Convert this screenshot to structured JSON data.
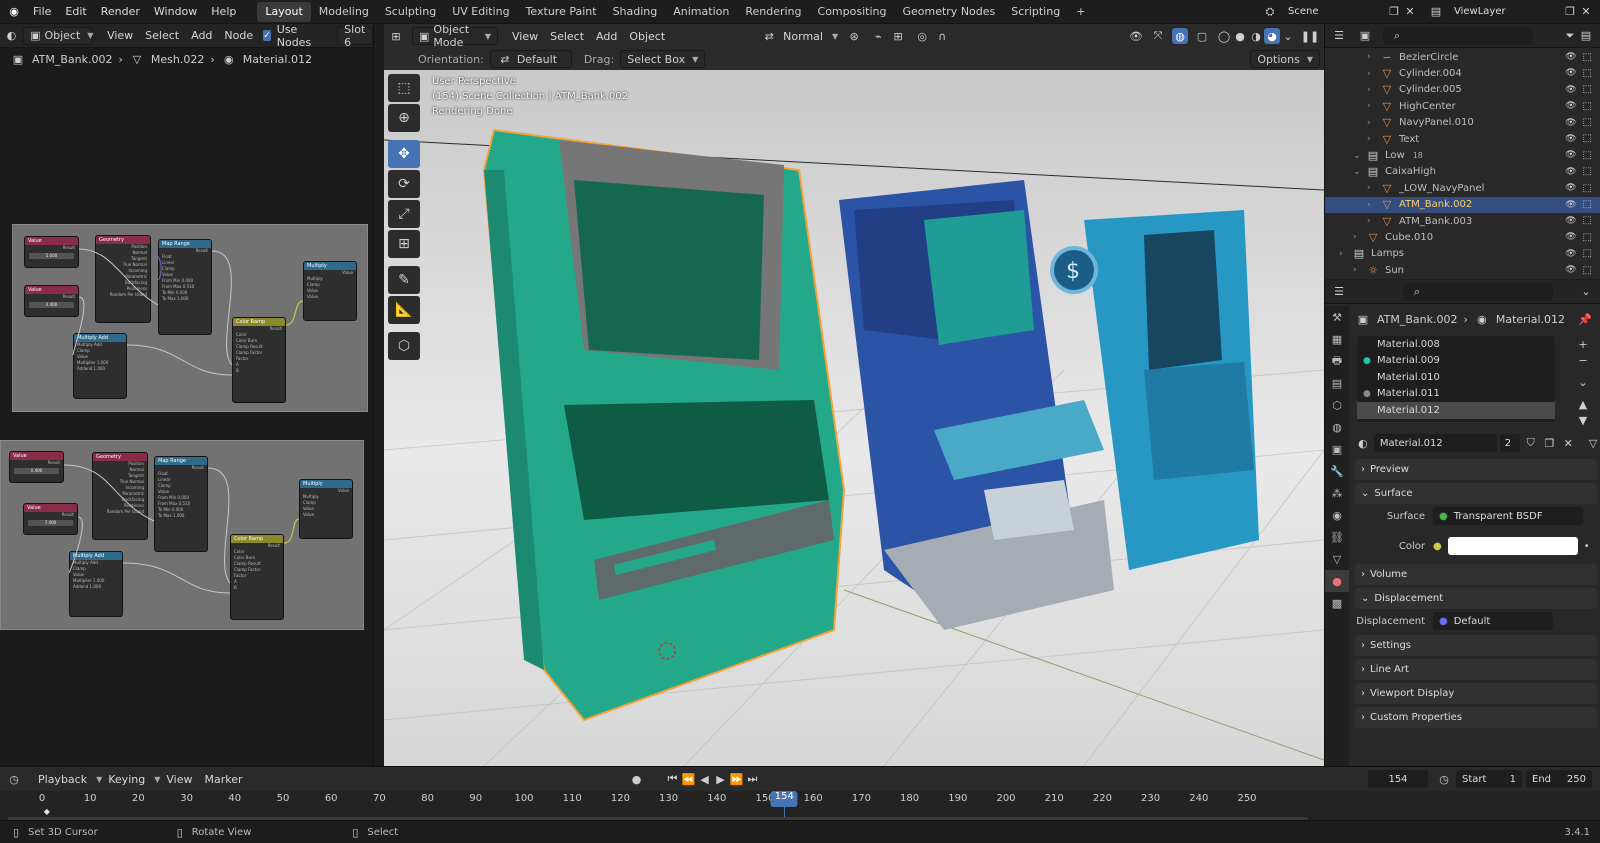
{
  "topbar": {
    "menus": [
      "File",
      "Edit",
      "Render",
      "Window",
      "Help"
    ],
    "workspaces": [
      "Layout",
      "Modeling",
      "Sculpting",
      "UV Editing",
      "Texture Paint",
      "Shading",
      "Animation",
      "Rendering",
      "Compositing",
      "Geometry Nodes",
      "Scripting"
    ],
    "active_workspace": "Layout",
    "add_workspace": "+",
    "scene": "Scene",
    "view_layer": "ViewLayer"
  },
  "node_editor": {
    "mode": "Object",
    "menus": [
      "View",
      "Select",
      "Add",
      "Node"
    ],
    "use_nodes_label": "Use Nodes",
    "slot": "Slot 6",
    "breadcrumb": [
      "ATM_Bank.002",
      "Mesh.022",
      "Material.012"
    ],
    "node_titles": {
      "value": "Value",
      "geometry": "Geometry",
      "map_range": "Map Range",
      "multiply": "Multiply",
      "multiply_add": "Multiply Add",
      "color_ramp": "Color Ramp"
    },
    "value_a": "5.000",
    "value_b": "0.400",
    "value_c": "0.400",
    "value_d": "7.000",
    "geometry_outputs": [
      "Position",
      "Normal",
      "Tangent",
      "True Normal",
      "Incoming",
      "Parametric",
      "Backfacing",
      "Pointiness",
      "Random Per Island"
    ],
    "map_range_fields": [
      "Float",
      "Linear",
      "Clamp",
      "Value",
      "From Min 0.000",
      "From Max 0.510",
      "To Min 0.000",
      "To Max 1.000"
    ],
    "multiply_add_fields": [
      "Multiply Add",
      "Clamp",
      "Value",
      "Multiplier 1.000",
      "Addend 1.000"
    ],
    "color_ramp_fields": [
      "Color",
      "Color Burn",
      "Clamp Result",
      "Clamp Factor",
      "Factor",
      "A",
      "B"
    ],
    "multiply_fields": [
      "Multiply",
      "Clamp",
      "Value",
      "Value"
    ],
    "result_label": "Result"
  },
  "viewport": {
    "mode": "Object Mode",
    "menus": [
      "View",
      "Select",
      "Add",
      "Object"
    ],
    "transform_orientation": "Normal",
    "orientation_label": "Orientation:",
    "orientation_value": "Default",
    "drag_label": "Drag:",
    "drag_value": "Select Box",
    "options_label": "Options",
    "overlay_lines": [
      "User Perspective",
      "(154) Scene Collection | ATM_Bank.002",
      "Rendering Done"
    ],
    "colors": {
      "teal": "#23a98a",
      "blue": "#2d5fb8",
      "cyan": "#2aa0c8",
      "selection": "#f4a23a"
    }
  },
  "outliner": {
    "rows": [
      {
        "name": "BezierCircle",
        "depth": 3,
        "icon": "curve-icon",
        "selected": false
      },
      {
        "name": "Cylinder.004",
        "depth": 3,
        "icon": "mesh-icon",
        "selected": false
      },
      {
        "name": "Cylinder.005",
        "depth": 3,
        "icon": "mesh-icon",
        "selected": false
      },
      {
        "name": "HighCenter",
        "depth": 3,
        "icon": "mesh-icon",
        "selected": false
      },
      {
        "name": "NavyPanel.010",
        "depth": 3,
        "icon": "mesh-icon",
        "selected": false
      },
      {
        "name": "Text",
        "depth": 3,
        "icon": "mesh-icon",
        "selected": false
      },
      {
        "name": "Low",
        "depth": 2,
        "icon": "collection-icon",
        "selected": false,
        "badge": "18"
      },
      {
        "name": "CaixaHigh",
        "depth": 2,
        "icon": "collection-icon",
        "selected": false
      },
      {
        "name": "_LOW_NavyPanel",
        "depth": 3,
        "icon": "mesh-icon",
        "selected": false
      },
      {
        "name": "ATM_Bank.002",
        "depth": 3,
        "icon": "mesh-icon",
        "selected": true
      },
      {
        "name": "ATM_Bank.003",
        "depth": 3,
        "icon": "mesh-icon",
        "selected": false
      },
      {
        "name": "Cube.010",
        "depth": 2,
        "icon": "mesh-icon",
        "selected": false
      },
      {
        "name": "Lamps",
        "depth": 1,
        "icon": "collection-icon",
        "selected": false
      },
      {
        "name": "Sun",
        "depth": 2,
        "icon": "light-icon",
        "selected": false
      }
    ]
  },
  "properties": {
    "breadcrumb_object": "ATM_Bank.002",
    "breadcrumb_material": "Material.012",
    "material_slots": [
      "Material.008",
      "Material.009",
      "Material.010",
      "Material.011",
      "Material.012"
    ],
    "active_slot_index": 4,
    "material_name": "Material.012",
    "users": "2",
    "panels": {
      "preview": "Preview",
      "surface": "Surface",
      "volume": "Volume",
      "displacement": "Displacement",
      "settings": "Settings",
      "line_art": "Line Art",
      "viewport_display": "Viewport Display",
      "custom_properties": "Custom Properties"
    },
    "surface_label": "Surface",
    "surface_value": "Transparent BSDF",
    "color_label": "Color",
    "color_value": "#ffffff",
    "displacement_label": "Displacement",
    "displacement_value": "Default"
  },
  "timeline": {
    "menus": [
      "Playback",
      "Keying",
      "View",
      "Marker"
    ],
    "current_frame": "154",
    "start_label": "Start",
    "start_value": "1",
    "end_label": "End",
    "end_value": "250",
    "ruler": [
      "0",
      "10",
      "20",
      "30",
      "40",
      "50",
      "60",
      "70",
      "80",
      "90",
      "100",
      "110",
      "120",
      "130",
      "140",
      "150",
      "160",
      "170",
      "180",
      "190",
      "200",
      "210",
      "220",
      "230",
      "240",
      "250"
    ]
  },
  "status": {
    "items": [
      "Set 3D Cursor",
      "Rotate View",
      "Select"
    ],
    "version": "3.4.1"
  }
}
